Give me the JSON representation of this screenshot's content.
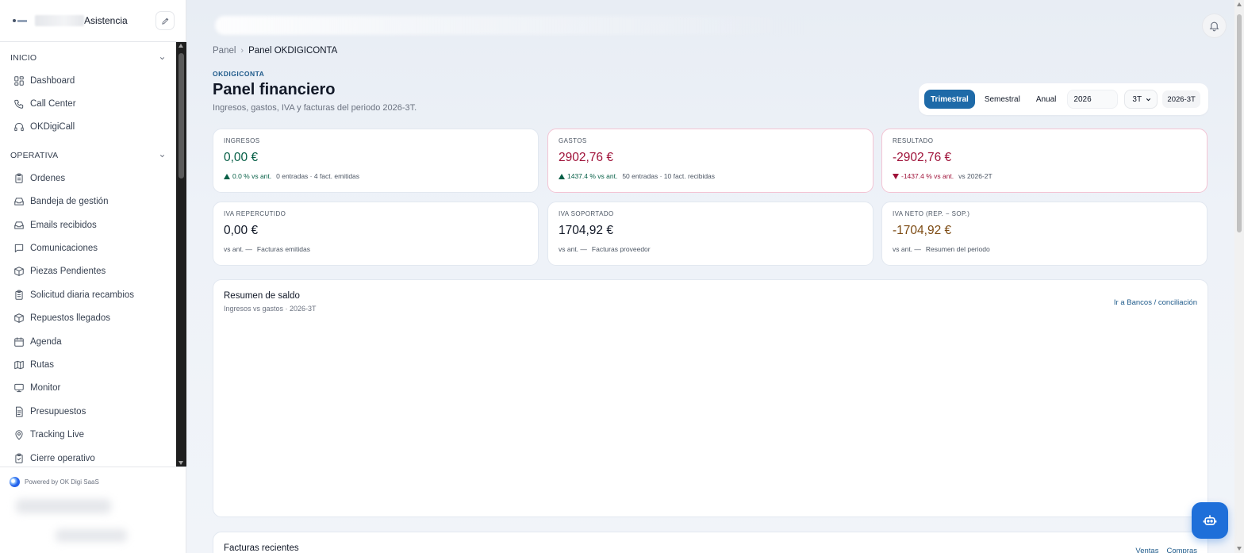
{
  "brand": {
    "name": "Asistencia"
  },
  "sidebar": {
    "sections": [
      {
        "label": "INICIO",
        "items": [
          {
            "label": "Dashboard",
            "icon": "dashboard-icon"
          },
          {
            "label": "Call Center",
            "icon": "phone-icon"
          },
          {
            "label": "OKDigiCall",
            "icon": "headset-icon"
          }
        ]
      },
      {
        "label": "OPERATIVA",
        "items": [
          {
            "label": "Ordenes",
            "icon": "clipboard-icon"
          },
          {
            "label": "Bandeja de gestión",
            "icon": "inbox-icon"
          },
          {
            "label": "Emails recibidos",
            "icon": "inbox-icon"
          },
          {
            "label": "Comunicaciones",
            "icon": "message-icon"
          },
          {
            "label": "Piezas Pendientes",
            "icon": "box-icon"
          },
          {
            "label": "Solicitud diaria recambios",
            "icon": "clipboard-icon"
          },
          {
            "label": "Repuestos llegados",
            "icon": "box-icon"
          },
          {
            "label": "Agenda",
            "icon": "calendar-icon"
          },
          {
            "label": "Rutas",
            "icon": "map-icon"
          },
          {
            "label": "Monitor",
            "icon": "monitor-icon"
          },
          {
            "label": "Presupuestos",
            "icon": "document-icon"
          },
          {
            "label": "Tracking Live",
            "icon": "location-pin-icon"
          },
          {
            "label": "Cierre operativo",
            "icon": "clipboard-check-icon"
          }
        ]
      }
    ],
    "footer": {
      "powered": "Powered by OK Digi SaaS"
    }
  },
  "breadcrumb": {
    "root": "Panel",
    "current": "Panel OKDIGICONTA"
  },
  "header": {
    "eyebrow": "OKDIGICONTA",
    "title": "Panel financiero",
    "subtitle": "Ingresos, gastos, IVA y facturas del periodo 2026-3T."
  },
  "period": {
    "options": [
      "Trimestral",
      "Semestral",
      "Anual"
    ],
    "active": "Trimestral",
    "year": "2026",
    "quarter": "3T",
    "badge": "2026-3T"
  },
  "kpis": [
    {
      "label": "INGRESOS",
      "value": "0,00 €",
      "value_color": "#065f46",
      "trend": "0.0 % vs ant.",
      "trend_dir": "up",
      "trend_color": "#065f46",
      "note": "0 entradas · 4 fact. emitidas",
      "border": "#e2e8f0"
    },
    {
      "label": "GASTOS",
      "value": "2902,76 €",
      "value_color": "#9f1239",
      "trend": "1437.4 % vs ant.",
      "trend_dir": "up",
      "trend_color": "#065f46",
      "note": "50 entradas · 10 fact. recibidas",
      "border": "#f3c4d4"
    },
    {
      "label": "RESULTADO",
      "value": "-2902,76 €",
      "value_color": "#9f1239",
      "trend": "-1437.4 % vs ant.",
      "trend_dir": "down",
      "trend_color": "#9f1239",
      "note": "vs 2026-2T",
      "border": "#f3c4d4"
    },
    {
      "label": "IVA REPERCUTIDO",
      "value": "0,00 €",
      "value_color": "#111827",
      "trend": "vs ant. —",
      "trend_dir": "none",
      "trend_color": "#4b5563",
      "note": "Facturas emitidas",
      "border": "#e2e8f0"
    },
    {
      "label": "IVA SOPORTADO",
      "value": "1704,92 €",
      "value_color": "#111827",
      "trend": "vs ant. —",
      "trend_dir": "none",
      "trend_color": "#4b5563",
      "note": "Facturas proveedor",
      "border": "#e2e8f0"
    },
    {
      "label": "IVA NETO (REP. − SOP.)",
      "value": "-1704,92 €",
      "value_color": "#7c4a12",
      "trend": "vs ant. —",
      "trend_dir": "none",
      "trend_color": "#4b5563",
      "note": "Resumen del periodo",
      "border": "#e2e8f0"
    }
  ],
  "balance": {
    "title": "Resumen de saldo",
    "subtitle": "Ingresos vs gastos · 2026-3T",
    "link": "Ir a Bancos / conciliación"
  },
  "invoices": {
    "title": "Facturas recientes",
    "tabs": [
      "Ventas",
      "Compras"
    ]
  }
}
